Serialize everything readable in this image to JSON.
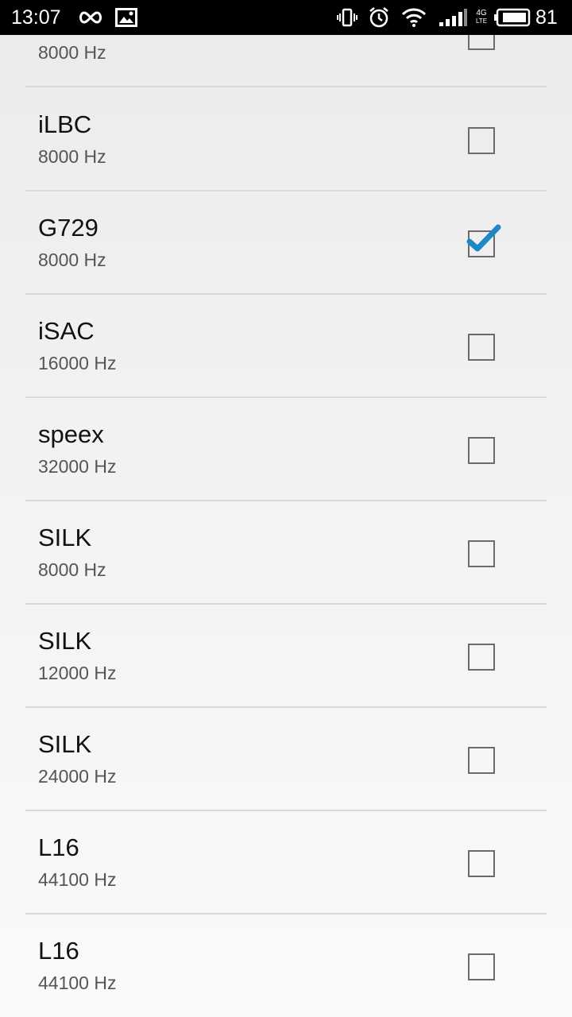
{
  "status_bar": {
    "time": "13:07",
    "battery": "81",
    "network_label": "4G"
  },
  "codecs": [
    {
      "name": "",
      "rate": "8000 Hz",
      "checked": false
    },
    {
      "name": "iLBC",
      "rate": "8000 Hz",
      "checked": false
    },
    {
      "name": "G729",
      "rate": "8000 Hz",
      "checked": true
    },
    {
      "name": "iSAC",
      "rate": "16000 Hz",
      "checked": false
    },
    {
      "name": "speex",
      "rate": "32000 Hz",
      "checked": false
    },
    {
      "name": "SILK",
      "rate": "8000 Hz",
      "checked": false
    },
    {
      "name": "SILK",
      "rate": "12000 Hz",
      "checked": false
    },
    {
      "name": "SILK",
      "rate": "24000 Hz",
      "checked": false
    },
    {
      "name": "L16",
      "rate": "44100 Hz",
      "checked": false
    },
    {
      "name": "L16",
      "rate": "44100 Hz",
      "checked": false
    }
  ],
  "colors": {
    "check_accent": "#1e88c7",
    "divider": "#d9d9d9"
  }
}
